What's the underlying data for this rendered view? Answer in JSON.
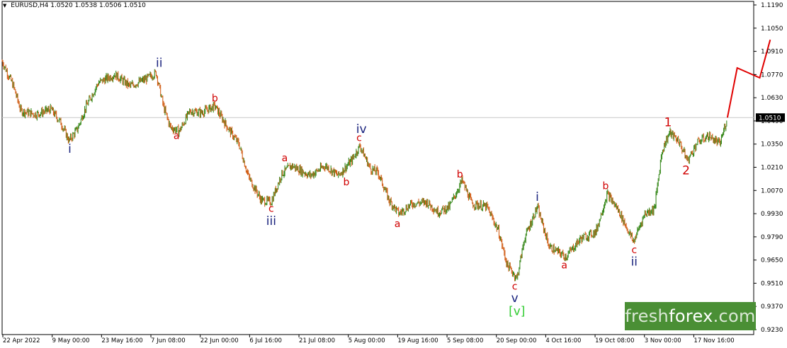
{
  "header": {
    "symbol": "EURUSD,H4",
    "ohlc": "1.0520 1.0538 1.0506 1.0510"
  },
  "brand": {
    "pre": "fresh",
    "name": "forex",
    "post": ".com"
  },
  "colors": {
    "up_candle": "#3a8a1e",
    "down_candle": "#d2601a",
    "projection": "#e00000",
    "wave_blue": "#1a237e",
    "wave_red": "#d00000",
    "wave_green": "#33cc33",
    "grid": "#c8c8c8",
    "price_label_bg": "#000000"
  },
  "chart_data": {
    "type": "candlestick",
    "instrument": "EURUSD",
    "timeframe": "H4",
    "current_price": "1.0510",
    "ylim": [
      0.921,
      1.12
    ],
    "y_ticks": [
      "1.1190",
      "1.1050",
      "1.0910",
      "1.0770",
      "1.0630",
      "1.0490",
      "1.0350",
      "1.0210",
      "1.0070",
      "0.9930",
      "0.9790",
      "0.9650",
      "0.9510",
      "0.9370",
      "0.9230"
    ],
    "x_ticks": [
      "22 Apr 2022",
      "9 May 00:00",
      "23 May 16:00",
      "7 Jun 08:00",
      "22 Jun 00:00",
      "6 Jul 16:00",
      "21 Jul 08:00",
      "5 Aug 00:00",
      "19 Aug 16:00",
      "5 Sep 08:00",
      "20 Sep 00:00",
      "4 Oct 16:00",
      "19 Oct 08:00",
      "3 Nov 00:00",
      "17 Nov 16:00"
    ],
    "price_path": [
      {
        "t": 0,
        "p": 1.085
      },
      {
        "t": 0.015,
        "p": 1.07
      },
      {
        "t": 0.025,
        "p": 1.055
      },
      {
        "t": 0.045,
        "p": 1.053
      },
      {
        "t": 0.065,
        "p": 1.056
      },
      {
        "t": 0.078,
        "p": 1.048
      },
      {
        "t": 0.089,
        "p": 1.037
      },
      {
        "t": 0.1,
        "p": 1.044
      },
      {
        "t": 0.112,
        "p": 1.058
      },
      {
        "t": 0.128,
        "p": 1.072
      },
      {
        "t": 0.15,
        "p": 1.077
      },
      {
        "t": 0.17,
        "p": 1.07
      },
      {
        "t": 0.19,
        "p": 1.074
      },
      {
        "t": 0.205,
        "p": 1.078
      },
      {
        "t": 0.215,
        "p": 1.057
      },
      {
        "t": 0.224,
        "p": 1.045
      },
      {
        "t": 0.236,
        "p": 1.043
      },
      {
        "t": 0.25,
        "p": 1.055
      },
      {
        "t": 0.265,
        "p": 1.054
      },
      {
        "t": 0.283,
        "p": 1.058
      },
      {
        "t": 0.3,
        "p": 1.045
      },
      {
        "t": 0.315,
        "p": 1.035
      },
      {
        "t": 0.328,
        "p": 1.015
      },
      {
        "t": 0.345,
        "p": 1.001
      },
      {
        "t": 0.358,
        "p": 1.0
      },
      {
        "t": 0.372,
        "p": 1.017
      },
      {
        "t": 0.385,
        "p": 1.022
      },
      {
        "t": 0.41,
        "p": 1.016
      },
      {
        "t": 0.43,
        "p": 1.022
      },
      {
        "t": 0.447,
        "p": 1.016
      },
      {
        "t": 0.465,
        "p": 1.025
      },
      {
        "t": 0.476,
        "p": 1.034
      },
      {
        "t": 0.49,
        "p": 1.02
      },
      {
        "t": 0.5,
        "p": 1.018
      },
      {
        "t": 0.515,
        "p": 1.001
      },
      {
        "t": 0.528,
        "p": 0.993
      },
      {
        "t": 0.545,
        "p": 0.999
      },
      {
        "t": 0.565,
        "p": 1.0
      },
      {
        "t": 0.58,
        "p": 0.994
      },
      {
        "t": 0.595,
        "p": 0.997
      },
      {
        "t": 0.612,
        "p": 1.013
      },
      {
        "t": 0.625,
        "p": 0.999
      },
      {
        "t": 0.645,
        "p": 0.997
      },
      {
        "t": 0.66,
        "p": 0.983
      },
      {
        "t": 0.672,
        "p": 0.962
      },
      {
        "t": 0.685,
        "p": 0.954
      },
      {
        "t": 0.695,
        "p": 0.978
      },
      {
        "t": 0.712,
        "p": 0.997
      },
      {
        "t": 0.728,
        "p": 0.973
      },
      {
        "t": 0.75,
        "p": 0.967
      },
      {
        "t": 0.77,
        "p": 0.978
      },
      {
        "t": 0.79,
        "p": 0.982
      },
      {
        "t": 0.805,
        "p": 1.005
      },
      {
        "t": 0.82,
        "p": 0.995
      },
      {
        "t": 0.84,
        "p": 0.976
      },
      {
        "t": 0.855,
        "p": 0.993
      },
      {
        "t": 0.868,
        "p": 0.996
      },
      {
        "t": 0.878,
        "p": 1.031
      },
      {
        "t": 0.888,
        "p": 1.042
      },
      {
        "t": 0.9,
        "p": 1.037
      },
      {
        "t": 0.912,
        "p": 1.025
      },
      {
        "t": 0.925,
        "p": 1.036
      },
      {
        "t": 0.94,
        "p": 1.04
      },
      {
        "t": 0.955,
        "p": 1.035
      },
      {
        "t": 0.965,
        "p": 1.051
      }
    ],
    "projection": [
      {
        "t": 0.965,
        "p": 1.051
      },
      {
        "t": 0.978,
        "p": 1.081
      },
      {
        "t": 1.008,
        "p": 1.075
      },
      {
        "t": 1.022,
        "p": 1.098
      }
    ],
    "wave_labels": [
      {
        "text": "i",
        "t": 0.09,
        "p": 1.037,
        "pos": "below",
        "color": "blue",
        "size": "large"
      },
      {
        "text": "ii",
        "t": 0.209,
        "p": 1.08,
        "pos": "above",
        "color": "blue",
        "size": "large"
      },
      {
        "text": "a",
        "t": 0.232,
        "p": 1.044,
        "pos": "below",
        "color": "red",
        "size": "small"
      },
      {
        "text": "b",
        "t": 0.283,
        "p": 1.059,
        "pos": "above",
        "color": "red",
        "size": "small"
      },
      {
        "text": "c",
        "t": 0.358,
        "p": 1.0,
        "pos": "below",
        "color": "red",
        "size": "small"
      },
      {
        "text": "iii",
        "t": 0.358,
        "p": 0.9935,
        "pos": "below",
        "color": "blue",
        "size": "large"
      },
      {
        "text": "a",
        "t": 0.376,
        "p": 1.023,
        "pos": "above",
        "color": "red",
        "size": "small"
      },
      {
        "text": "b",
        "t": 0.458,
        "p": 1.016,
        "pos": "below",
        "color": "red",
        "size": "small"
      },
      {
        "text": "c",
        "t": 0.475,
        "p": 1.035,
        "pos": "above",
        "color": "red",
        "size": "small"
      },
      {
        "text": "iv",
        "t": 0.478,
        "p": 1.04,
        "pos": "above",
        "color": "blue",
        "size": "large"
      },
      {
        "text": "a",
        "t": 0.526,
        "p": 0.991,
        "pos": "below",
        "color": "red",
        "size": "small"
      },
      {
        "text": "b",
        "t": 0.609,
        "p": 1.013,
        "pos": "above",
        "color": "red",
        "size": "small"
      },
      {
        "text": "c",
        "t": 0.682,
        "p": 0.953,
        "pos": "below",
        "color": "red",
        "size": "small"
      },
      {
        "text": "v",
        "t": 0.682,
        "p": 0.947,
        "pos": "below",
        "color": "blue",
        "size": "large"
      },
      {
        "text": "[v]",
        "t": 0.685,
        "p": 0.939,
        "pos": "below",
        "color": "green",
        "size": "large"
      },
      {
        "text": "i",
        "t": 0.712,
        "p": 0.999,
        "pos": "above",
        "color": "blue",
        "size": "large"
      },
      {
        "text": "a",
        "t": 0.748,
        "p": 0.966,
        "pos": "below",
        "color": "red",
        "size": "small"
      },
      {
        "text": "b",
        "t": 0.803,
        "p": 1.006,
        "pos": "above",
        "color": "red",
        "size": "small"
      },
      {
        "text": "c",
        "t": 0.841,
        "p": 0.975,
        "pos": "below",
        "color": "red",
        "size": "small"
      },
      {
        "text": "ii",
        "t": 0.841,
        "p": 0.969,
        "pos": "below",
        "color": "blue",
        "size": "large"
      },
      {
        "text": "1",
        "t": 0.886,
        "p": 1.044,
        "pos": "above",
        "color": "red",
        "size": "large"
      },
      {
        "text": "2",
        "t": 0.91,
        "p": 1.024,
        "pos": "below",
        "color": "red",
        "size": "large"
      }
    ]
  }
}
